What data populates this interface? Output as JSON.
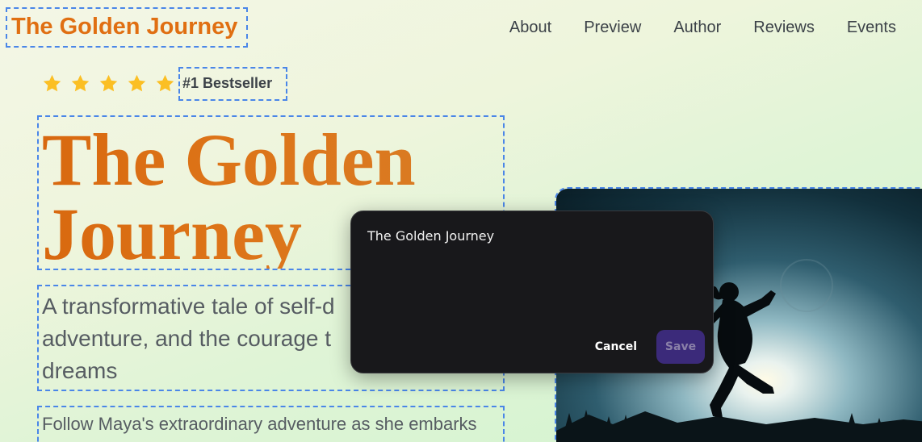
{
  "header": {
    "brand": "The Golden Journey",
    "nav": [
      "About",
      "Preview",
      "Author",
      "Reviews",
      "Events"
    ]
  },
  "rating": {
    "stars": 5,
    "star_color": "#fbbf24",
    "badge": "#1 Bestseller"
  },
  "hero": {
    "title_line1": "The Golden",
    "title_line2": "Journey",
    "subtitle_part1": "A transformative tale of self-d",
    "subtitle_part2": "adventure, and the courage t",
    "subtitle_part3": "dreams",
    "description": "Follow Maya's extraordinary adventure as she embarks"
  },
  "dialog": {
    "input_value": "The Golden Journey",
    "cancel_label": "Cancel",
    "save_label": "Save"
  },
  "colors": {
    "brand": "#e06f12",
    "accent_purple": "#3b2a7a",
    "dialog_bg": "#18181b"
  }
}
